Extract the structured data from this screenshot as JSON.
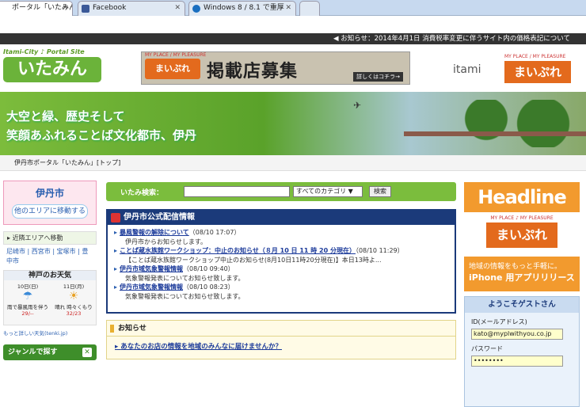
{
  "browser": {
    "tabs": [
      {
        "label": "ポータル「いたみん」",
        "active": true
      },
      {
        "label": "Facebook",
        "active": false
      },
      {
        "label": "Windows 8 / 8.1 で重厚",
        "active": false
      }
    ]
  },
  "notice": "お知らせ：2014年4月1日 消費税率変更に伴うサイト内の価格表記について",
  "header": {
    "logo_sub": "Itami-City ♪ Portal Site",
    "logo_main": "いたみん",
    "banner_tag": "MY PLACE / MY PLEASURE",
    "banner_badge": "まいぷれ",
    "banner_title": "掲載店募集",
    "banner_more": "詳しくはコチラ→",
    "itami": "itami",
    "mp_tag": "MY PLACE / MY PLEASURE",
    "mp_name": "まいぷれ"
  },
  "hero": {
    "line1": "大空と緑、歴史そして",
    "line2": "笑顔あふれることば文化都市、伊丹"
  },
  "breadcrumb": "伊丹市ポータル「いたみん」[トップ]",
  "left": {
    "city": "伊丹市",
    "move_button": "他のエリアに移動する",
    "near_label": "近隣エリアへ移動",
    "near_links": "尼崎市 | 西宮市 | 宝塚市 | 豊中市",
    "weather_title": "神戸のお天気",
    "weather": [
      {
        "day": "10日(日)",
        "desc": "雨で暴風雨を伴う",
        "temp": "29/--"
      },
      {
        "day": "11日(月)",
        "desc": "晴れ 時々くもり",
        "temp": "32/23"
      }
    ],
    "weather_more": "もっと詳しい天気(tenki.jp)",
    "genre": "ジャンルで探す"
  },
  "search": {
    "label": "いたみ検索：",
    "category": "すべてのカテゴリ ▼",
    "button": "検索"
  },
  "official": {
    "title": "伊丹市公式配信情報",
    "items": [
      {
        "title": "暴風警報の解除について",
        "date": "（08/10 17:07）",
        "sub": "伊丹市からお知らせします。"
      },
      {
        "title": "ことば蔵水族館ワークショップ：中止のお知らせ（８月 10 日 11 時 20 分現在）",
        "date": "（08/10 11:29）",
        "sub": "【ことば蔵水族館ワークショップ中止のお知らせ(8月10日11時20分現在)】本日13時よ..."
      },
      {
        "title": "伊丹市域気象警報情報",
        "date": "（08/10 09:40）",
        "sub": "気象警報発表についてお知らせ致します。"
      },
      {
        "title": "伊丹市域気象警報情報",
        "date": "（08/10 08:23）",
        "sub": "気象警報発表についてお知らせ致します。"
      }
    ]
  },
  "oshirase": {
    "title": "お知らせ",
    "link": "あなたのお店の情報を地域のみんなに届けませんか？"
  },
  "right": {
    "headline": "Headline",
    "mp_tag": "MY PLACE ♪ MY PLEASURE",
    "mp_name": "まいぷれ",
    "app_line1": "地域の情報をもっと手軽に。",
    "app_line2": "iPhone 用アプリリリース",
    "welcome": "ようこそゲストさん",
    "id_label": "ID(メールアドレス)",
    "id_value": "kato@myplwithyou.co.jp",
    "pw_label": "パスワード",
    "pw_value": "••••••••"
  }
}
